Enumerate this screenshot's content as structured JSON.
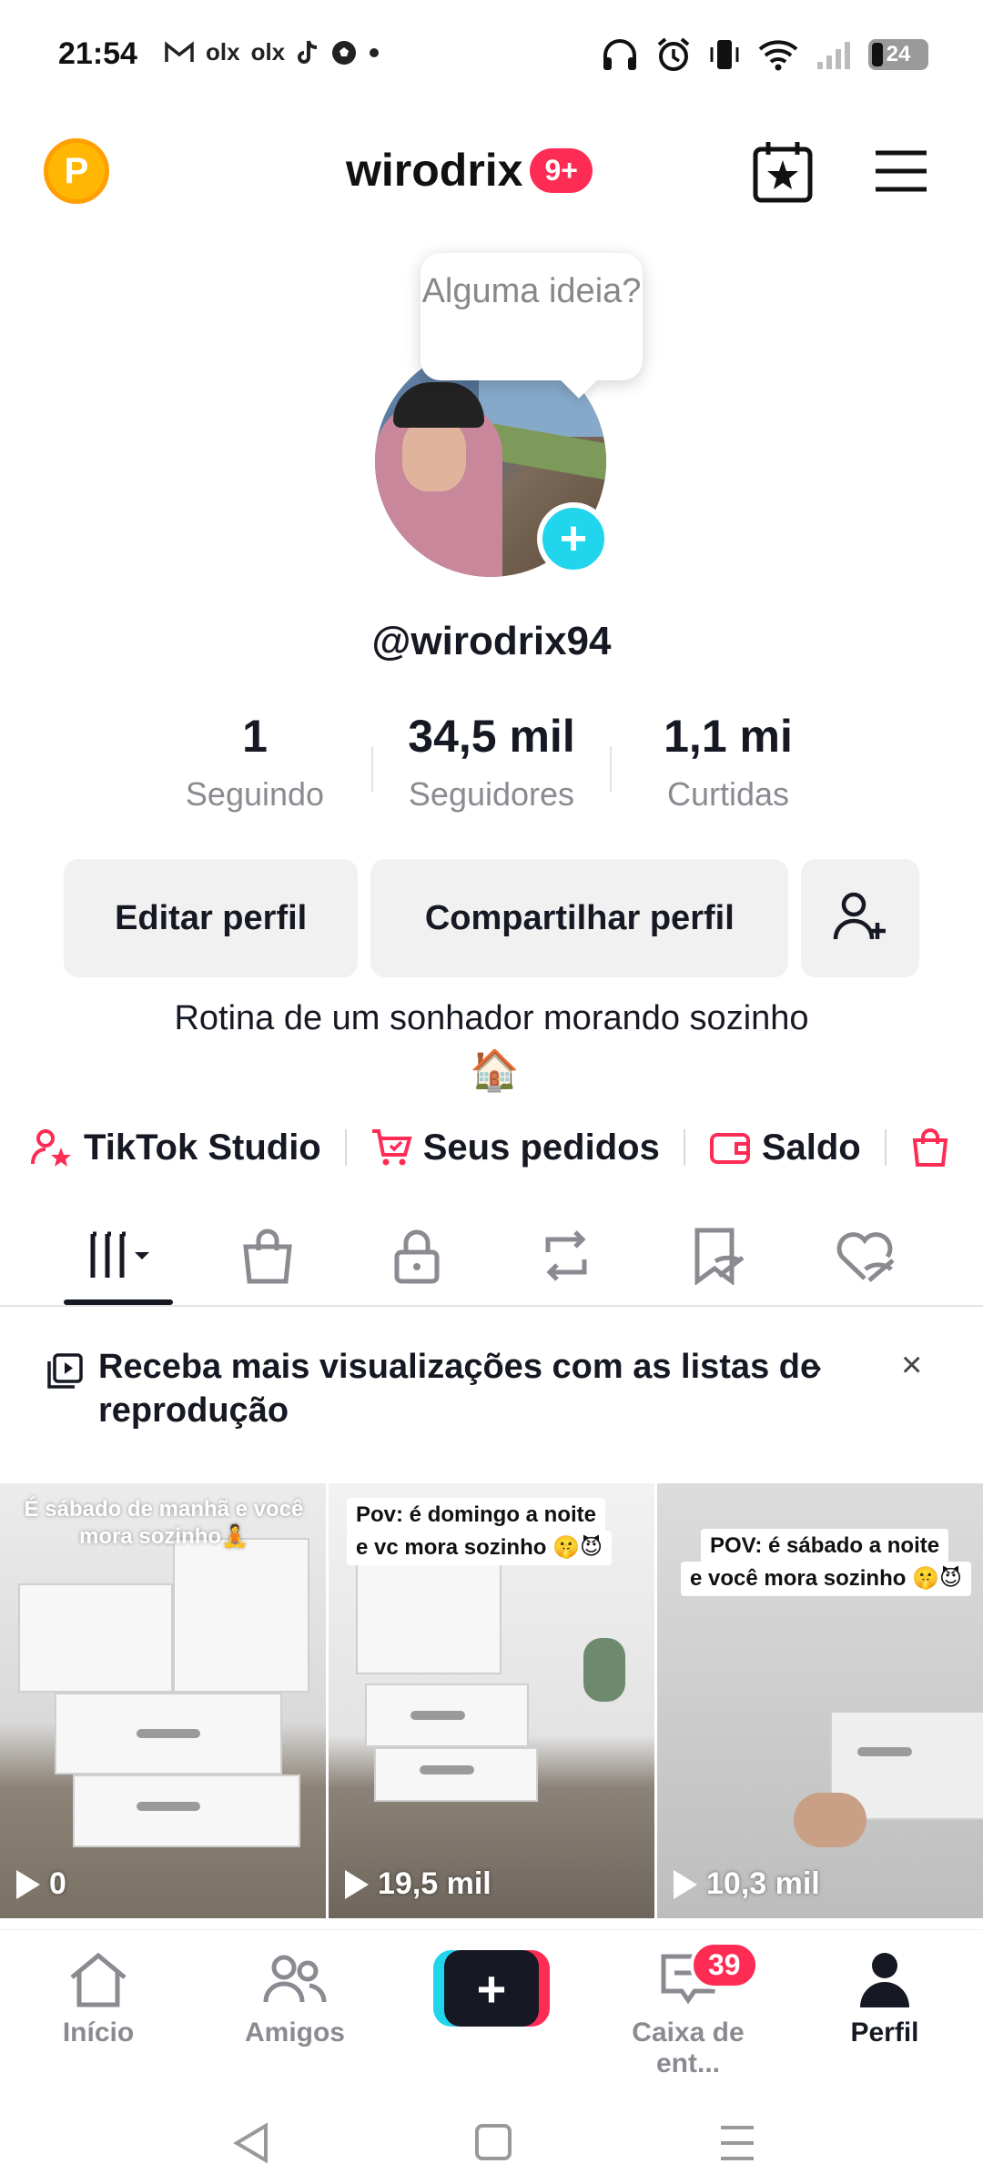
{
  "status_bar": {
    "time": "21:54",
    "left_icons": [
      "gmail-icon",
      "olx-icon",
      "olx-icon",
      "tiktok-icon",
      "soccer-ball-icon",
      "dot-icon"
    ],
    "olx_label": "olx",
    "battery": "24"
  },
  "header": {
    "title": "wirodrix",
    "badge": "9+",
    "coin_letter": "P"
  },
  "profile": {
    "tooltip": "Alguma ideia?",
    "username": "@wirodrix94",
    "bio": "Rotina de um sonhador morando sozinho",
    "bio_emoji": "🏠"
  },
  "stats": [
    {
      "value": "1",
      "label": "Seguindo"
    },
    {
      "value": "34,5 mil",
      "label": "Seguidores"
    },
    {
      "value": "1,1 mi",
      "label": "Curtidas"
    }
  ],
  "actions": {
    "edit": "Editar perfil",
    "share": "Compartilhar perfil"
  },
  "links": {
    "studio": "TikTok Studio",
    "orders": "Seus pedidos",
    "balance": "Saldo"
  },
  "promo": {
    "text": "Receba mais visualizações com as listas de reprodução",
    "close": "×",
    "chevron": "›"
  },
  "videos": [
    {
      "caption": "É sábado de manhã e você mora sozinho🧘",
      "views": "0"
    },
    {
      "caption_line1": "Pov: é domingo a noite",
      "caption_line2": "e vc mora sozinho 🤫😈",
      "views": "19,5 mil"
    },
    {
      "caption_line1": "POV: é sábado a noite",
      "caption_line2": "e você mora sozinho 🤫😈",
      "views": "10,3 mil"
    }
  ],
  "bottom_nav": {
    "home": "Início",
    "friends": "Amigos",
    "create": "+",
    "inbox": "Caixa de ent...",
    "inbox_badge": "39",
    "profile": "Perfil"
  },
  "colors": {
    "accent_pink": "#fe2c55",
    "accent_cyan": "#20d5ec",
    "text_primary": "#161823",
    "text_secondary": "#8a8b91"
  }
}
